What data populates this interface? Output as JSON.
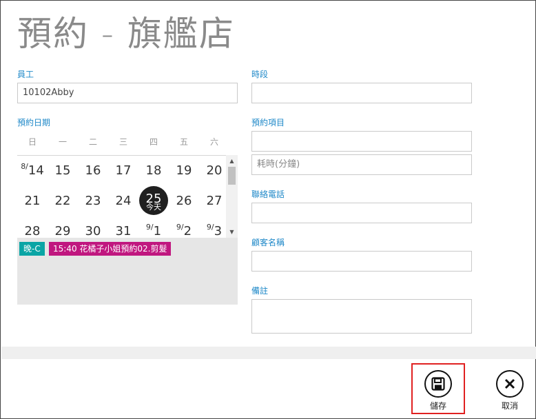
{
  "page": {
    "title": "預約 - 旗艦店"
  },
  "form": {
    "employee_label": "員工",
    "employee_value": "10102Abby",
    "date_label": "預約日期",
    "timeslot_label": "時段",
    "timeslot_value": "",
    "service_label": "預約項目",
    "service_value": "",
    "duration_placeholder": "耗時(分鐘)",
    "phone_label": "聯絡電話",
    "phone_value": "",
    "customer_label": "顧客名稱",
    "customer_value": "",
    "note_label": "備註",
    "note_value": ""
  },
  "calendar": {
    "weekdays": [
      "日",
      "一",
      "二",
      "三",
      "四",
      "五",
      "六"
    ],
    "week1": [
      {
        "mon": "8/",
        "day": "14"
      },
      {
        "mon": "",
        "day": "15"
      },
      {
        "mon": "",
        "day": "16"
      },
      {
        "mon": "",
        "day": "17"
      },
      {
        "mon": "",
        "day": "18"
      },
      {
        "mon": "",
        "day": "19"
      },
      {
        "mon": "",
        "day": "20"
      }
    ],
    "week2": [
      {
        "mon": "",
        "day": "21"
      },
      {
        "mon": "",
        "day": "22"
      },
      {
        "mon": "",
        "day": "23"
      },
      {
        "mon": "",
        "day": "24"
      },
      {
        "mon": "",
        "day": "25",
        "today": true
      },
      {
        "mon": "",
        "day": "26"
      },
      {
        "mon": "",
        "day": "27"
      }
    ],
    "week3": [
      {
        "mon": "",
        "day": "28"
      },
      {
        "mon": "",
        "day": "29"
      },
      {
        "mon": "",
        "day": "30"
      },
      {
        "mon": "",
        "day": "31"
      },
      {
        "mon": "9/",
        "day": "1"
      },
      {
        "mon": "9/",
        "day": "2"
      },
      {
        "mon": "9/",
        "day": "3"
      }
    ],
    "today_label": "今天"
  },
  "events": {
    "shift_chip": {
      "text": "晚-C",
      "color": "#0aa5a5"
    },
    "appointment_chip": {
      "text": "15:40 花橘子小姐預約02.剪髮",
      "color": "#c0177f"
    }
  },
  "actions": {
    "save_label": "儲存",
    "cancel_label": "取消",
    "save_icon": "floppy-disk-icon",
    "cancel_icon": "close-icon"
  }
}
